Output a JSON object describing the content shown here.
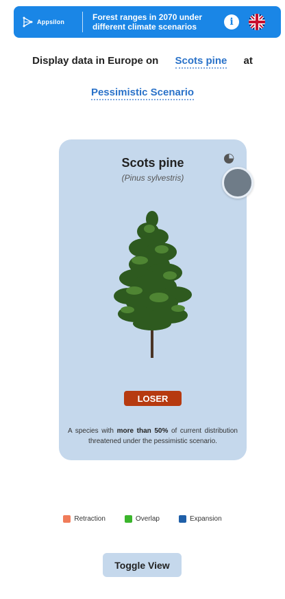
{
  "header": {
    "brand": "Appsilon",
    "title": "Forest ranges in 2070 under different climate scenarios",
    "info_icon": "info-icon",
    "language_icon": "uk-flag-icon"
  },
  "selector": {
    "prefix": "Display data in Europe on",
    "species": "Scots pine",
    "joiner": "at",
    "scenario": "Pessimistic Scenario"
  },
  "card": {
    "name": "Scots pine",
    "latin": "(Pinus sylvestris)",
    "badge": "LOSER",
    "badge_color": "#b63a10",
    "description": {
      "before": "A species with",
      "bold": "more than 50%",
      "after": "of current distribution threatened under the pessimistic scenario."
    }
  },
  "legend": [
    {
      "label": "Retraction",
      "color": "#f07c5a"
    },
    {
      "label": "Overlap",
      "color": "#3bb52c"
    },
    {
      "label": "Expansion",
      "color": "#1f5fa8"
    }
  ],
  "toggle": {
    "label": "Toggle View"
  }
}
